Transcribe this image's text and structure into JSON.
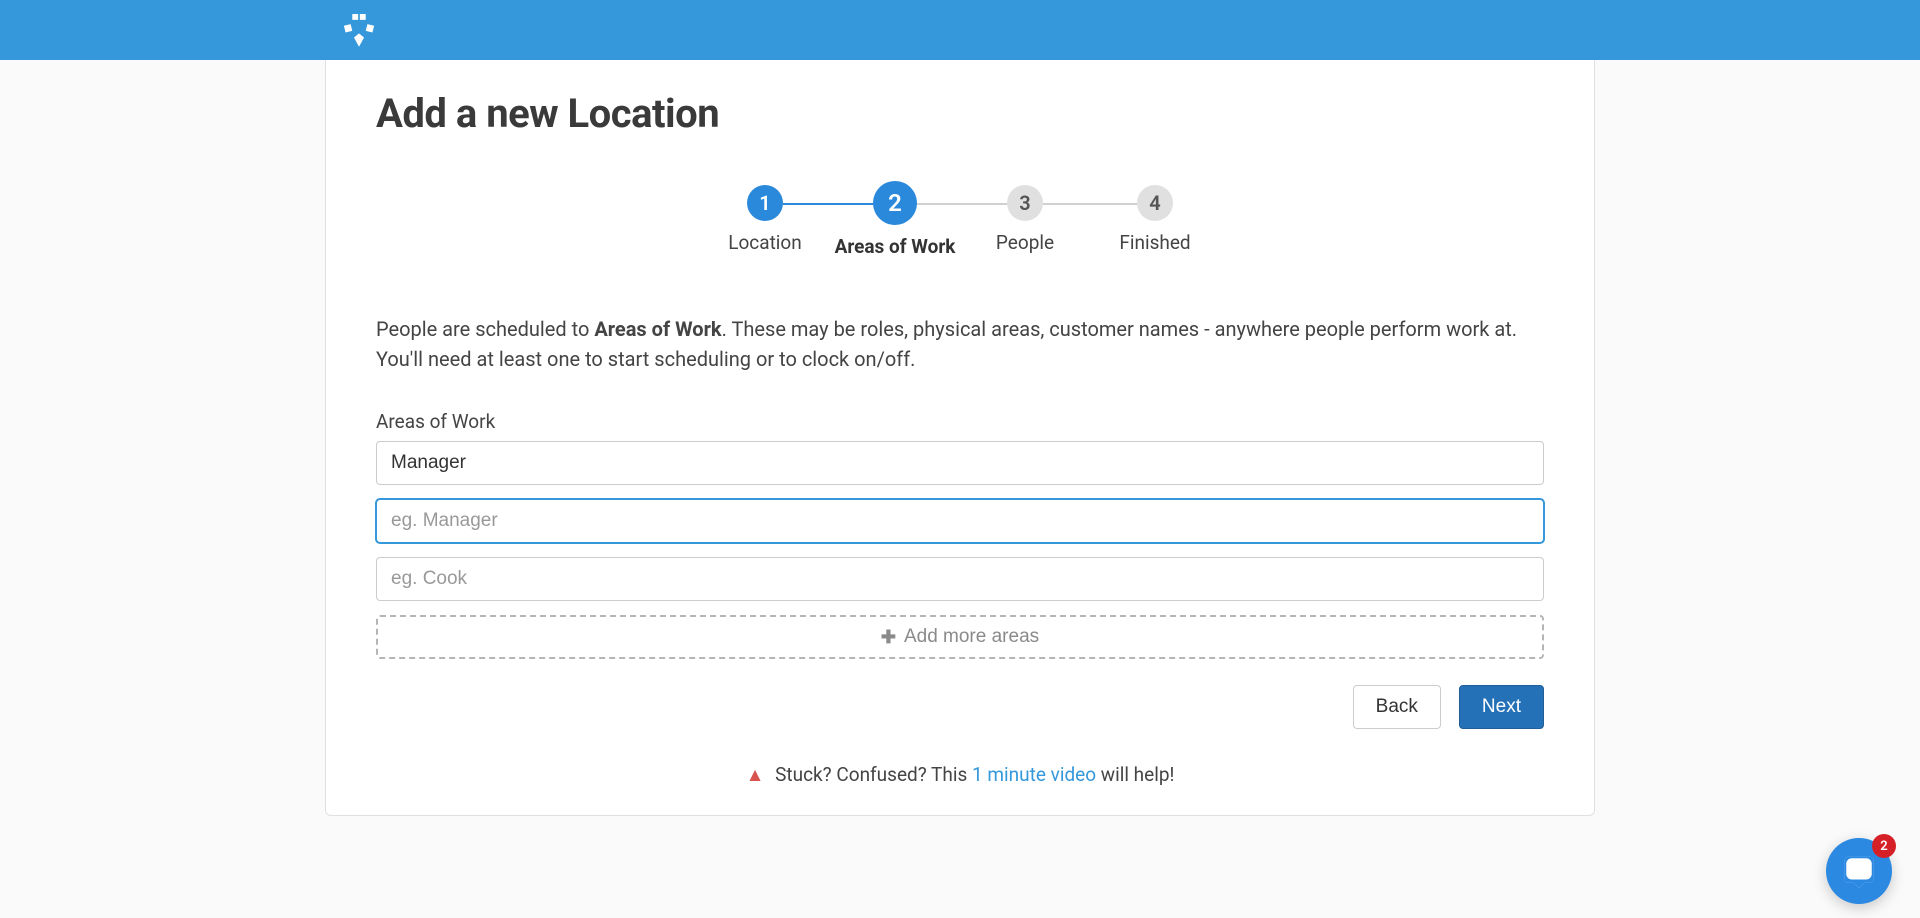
{
  "page": {
    "title": "Add a new Location"
  },
  "stepper": {
    "steps": [
      {
        "num": "1",
        "label": "Location",
        "state": "done"
      },
      {
        "num": "2",
        "label": "Areas of Work",
        "state": "active"
      },
      {
        "num": "3",
        "label": "People",
        "state": "inactive"
      },
      {
        "num": "4",
        "label": "Finished",
        "state": "inactive"
      }
    ]
  },
  "description": {
    "prefix": "People are scheduled to ",
    "bold": "Areas of Work",
    "suffix": ". These may be roles, physical areas, customer names - anywhere people perform work at. You'll need at least one to start scheduling or to clock on/off."
  },
  "form": {
    "field_label": "Areas of Work",
    "inputs": [
      {
        "value": "Manager",
        "placeholder": "",
        "focused": false
      },
      {
        "value": "",
        "placeholder": "eg. Manager",
        "focused": true
      },
      {
        "value": "",
        "placeholder": "eg. Cook",
        "focused": false
      }
    ],
    "add_more_label": "Add more areas"
  },
  "buttons": {
    "back": "Back",
    "next": "Next"
  },
  "help": {
    "prefix": "Stuck? Confused? This ",
    "link": "1 minute video",
    "suffix": " will help!"
  },
  "chat": {
    "badge": "2"
  }
}
